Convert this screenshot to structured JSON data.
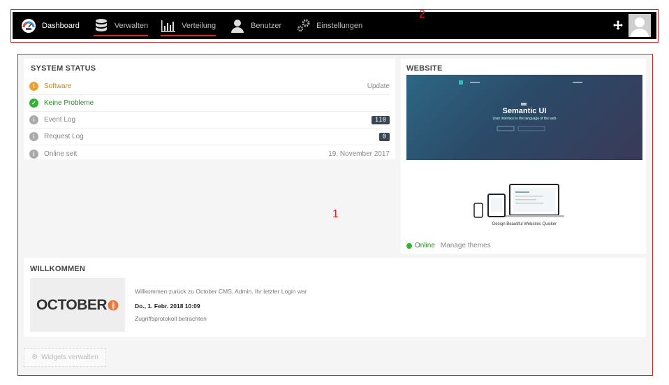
{
  "annotations": {
    "top_label": "2",
    "main_label": "1"
  },
  "nav": {
    "items": [
      {
        "label": "Dashboard",
        "icon": "dashboard-icon"
      },
      {
        "label": "Verwalten",
        "icon": "database-icon"
      },
      {
        "label": "Verteilung",
        "icon": "bar-chart-icon"
      },
      {
        "label": "Benutzer",
        "icon": "user-icon"
      },
      {
        "label": "Einstellungen",
        "icon": "gears-icon"
      }
    ],
    "move_icon": "move-icon",
    "avatar": "avatar"
  },
  "system_status": {
    "title": "SYSTEM STATUS",
    "rows": [
      {
        "label": "Software",
        "value": "Update",
        "status": "warning",
        "color": "#f0a030",
        "text_color": "#c08a2c"
      },
      {
        "label": "Keine Probleme",
        "value": "",
        "status": "ok",
        "color": "#34b233",
        "text_color": "#2c8a2c"
      },
      {
        "label": "Event Log",
        "value": "110",
        "status": "info",
        "color": "#aaaaaa",
        "text_color": "#888888"
      },
      {
        "label": "Request Log",
        "value": "0",
        "status": "info",
        "color": "#aaaaaa",
        "text_color": "#888888"
      },
      {
        "label": "Online seit",
        "value": "19. November 2017",
        "status": "info",
        "color": "#aaaaaa",
        "text_color": "#888888"
      }
    ]
  },
  "website": {
    "title": "WEBSITE",
    "hero_title": "Semantic UI",
    "hero_subtitle": "User interface is the language of the web",
    "promo_caption": "Design Beautiful Websites Quicker",
    "status_label": "Online",
    "manage_link": "Manage themes"
  },
  "welcome": {
    "title": "WILLKOMMEN",
    "logo_text": "OCTOBER",
    "line1": "Willkommen zurück zu October CMS, Admin. Ihr letzter Login war",
    "line2": "Do., 1. Febr. 2018 10:09",
    "line3": "Zugriffsprotokoll betrachten"
  },
  "widgets_button": {
    "label": "Widgets verwalten"
  }
}
